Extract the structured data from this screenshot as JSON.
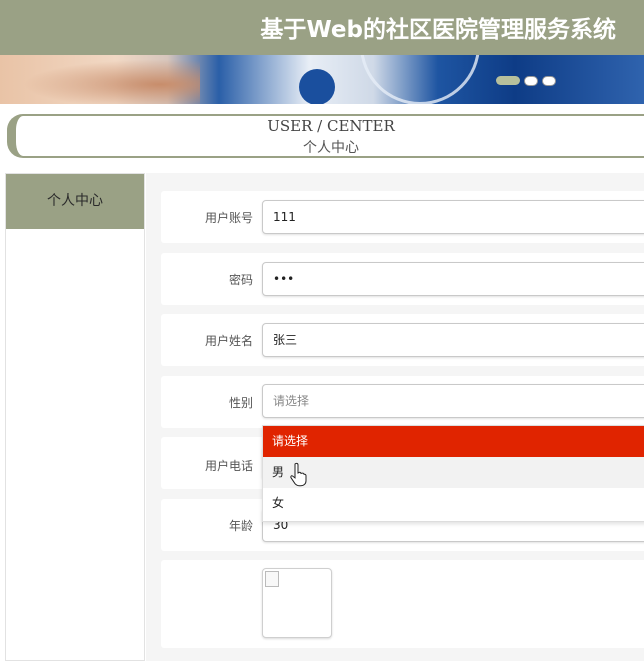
{
  "header": {
    "title": "基于Web的社区医院管理服务系统"
  },
  "banner": {
    "carousel": {
      "slides": 3,
      "active_index": 0
    }
  },
  "section": {
    "title_en": "USER / CENTER",
    "title_cn": "个人中心"
  },
  "sidebar": {
    "items": [
      {
        "label": "个人中心",
        "active": true
      }
    ]
  },
  "form": {
    "fields": [
      {
        "label": "用户账号",
        "value": "111"
      },
      {
        "label": "密码",
        "value": "•••"
      },
      {
        "label": "用户姓名",
        "value": "张三"
      },
      {
        "label": "性别",
        "value": "",
        "placeholder": "请选择"
      },
      {
        "label": "用户电话",
        "value": ""
      },
      {
        "label": "年龄",
        "value": "30"
      }
    ],
    "gender_options": [
      "请选择",
      "男",
      "女"
    ],
    "gender_selected_index": 0,
    "gender_hover_index": 1
  },
  "colors": {
    "primary": "#9aa185",
    "danger": "#e02400"
  }
}
